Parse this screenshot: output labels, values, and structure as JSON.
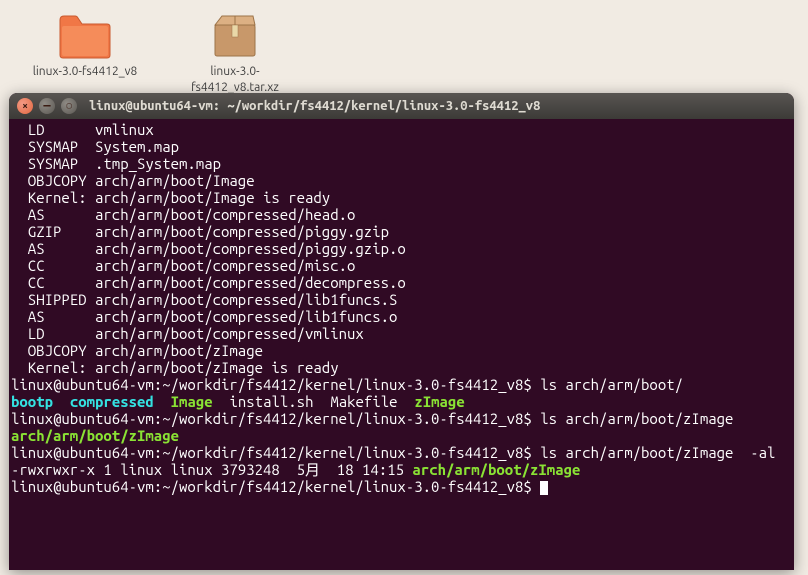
{
  "desktop": {
    "icons": [
      {
        "label": "linux-3.0-fs4412_v8",
        "type": "folder"
      },
      {
        "label": "linux-3.0-fs4412_v8.tar.xz",
        "type": "archive"
      }
    ]
  },
  "window": {
    "title": "linux@ubuntu64-vm: ~/workdir/fs4412/kernel/linux-3.0-fs4412_v8"
  },
  "terminal": {
    "build_lines": [
      {
        "step": "LD",
        "path": "vmlinux"
      },
      {
        "step": "SYSMAP",
        "path": "System.map"
      },
      {
        "step": "SYSMAP",
        "path": ".tmp_System.map"
      },
      {
        "step": "OBJCOPY",
        "path": "arch/arm/boot/Image"
      },
      {
        "step": "Kernel:",
        "path": "arch/arm/boot/Image is ready"
      },
      {
        "step": "AS",
        "path": "arch/arm/boot/compressed/head.o"
      },
      {
        "step": "GZIP",
        "path": "arch/arm/boot/compressed/piggy.gzip"
      },
      {
        "step": "AS",
        "path": "arch/arm/boot/compressed/piggy.gzip.o"
      },
      {
        "step": "CC",
        "path": "arch/arm/boot/compressed/misc.o"
      },
      {
        "step": "CC",
        "path": "arch/arm/boot/compressed/decompress.o"
      },
      {
        "step": "SHIPPED",
        "path": "arch/arm/boot/compressed/lib1funcs.S"
      },
      {
        "step": "AS",
        "path": "arch/arm/boot/compressed/lib1funcs.o"
      },
      {
        "step": "LD",
        "path": "arch/arm/boot/compressed/vmlinux"
      },
      {
        "step": "OBJCOPY",
        "path": "arch/arm/boot/zImage"
      },
      {
        "step": "Kernel:",
        "path": "arch/arm/boot/zImage is ready"
      }
    ],
    "prompt_user": "linux@ubuntu64-vm",
    "prompt_path": "~/workdir/fs4412/kernel/linux-3.0-fs4412_v8",
    "cmd1": "ls arch/arm/boot/",
    "ls1": {
      "bootp": "bootp",
      "compressed": "compressed",
      "image": "Image",
      "install": "install.sh",
      "makefile": "Makefile",
      "zimage": "zImage"
    },
    "cmd2": "ls arch/arm/boot/zImage",
    "ls2_out": "arch/arm/boot/zImage",
    "cmd3": "ls arch/arm/boot/zImage  -al",
    "ls3_line_prefix": "-rwxrwxr-x 1 linux linux 3793248  5月  18 14:15 ",
    "ls3_file": "arch/arm/boot/zImage"
  }
}
